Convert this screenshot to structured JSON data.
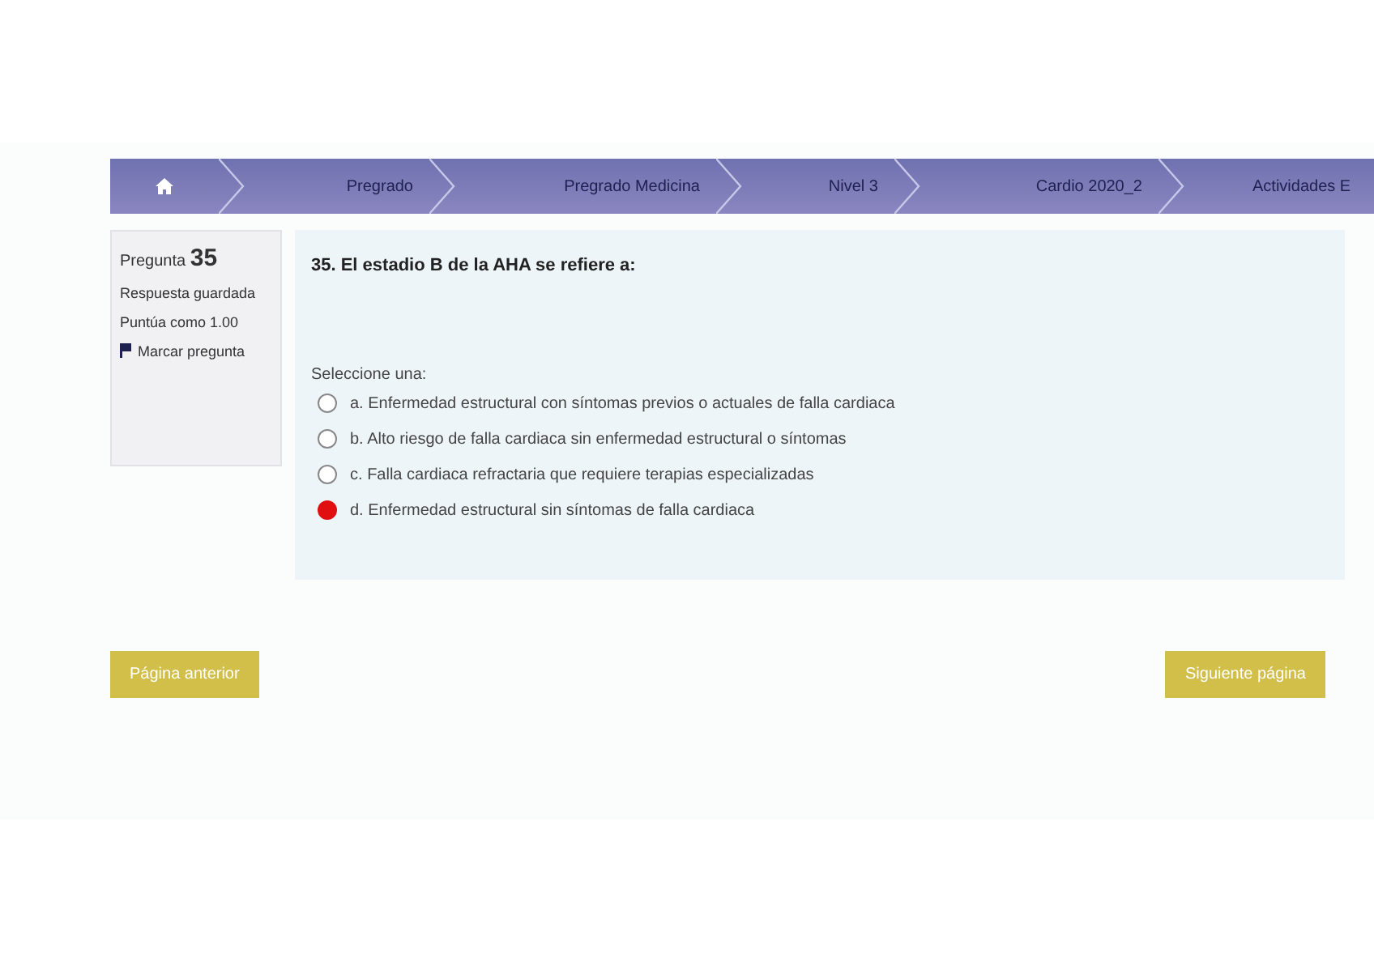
{
  "breadcrumb": [
    {
      "kind": "home"
    },
    {
      "kind": "link",
      "label": "Pregrado"
    },
    {
      "kind": "link",
      "label": "Pregrado Medicina"
    },
    {
      "kind": "link",
      "label": "Nivel 3"
    },
    {
      "kind": "link",
      "label": "Cardio 2020_2"
    },
    {
      "kind": "link",
      "label": "Actividades E"
    }
  ],
  "info": {
    "question_label": "Pregunta",
    "question_number": "35",
    "status": "Respuesta guardada",
    "score": "Puntúa como 1.00",
    "flag": "Marcar pregunta"
  },
  "question": {
    "text": "35. El estadio B de la AHA se refiere a:",
    "prompt": "Seleccione una:",
    "options": [
      {
        "letter": "a.",
        "text": "Enfermedad estructural con síntomas previos o actuales de falla cardiaca",
        "selected": false
      },
      {
        "letter": "b.",
        "text": "Alto riesgo de falla cardiaca sin enfermedad estructural o síntomas",
        "selected": false
      },
      {
        "letter": "c.",
        "text": "Falla cardiaca refractaria que requiere terapias especializadas",
        "selected": false
      },
      {
        "letter": "d.",
        "text": "Enfermedad estructural sin síntomas de falla cardiaca",
        "selected": true
      }
    ]
  },
  "buttons": {
    "previous": "Página anterior",
    "next": "Siguiente página"
  }
}
